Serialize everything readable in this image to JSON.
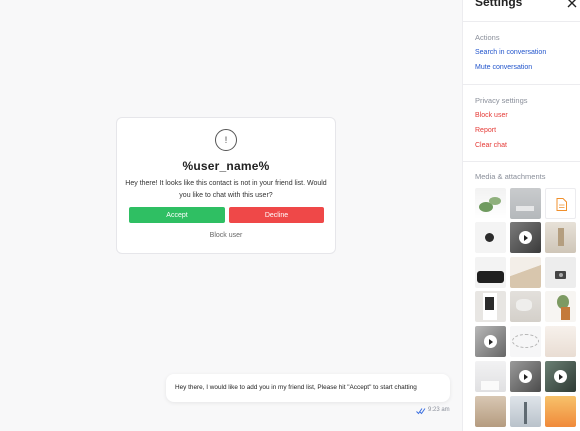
{
  "chat": {
    "request": {
      "user_name": "%user_name%",
      "message": "Hey there! It looks like this contact is not in your friend list. Would you like to chat with this user?",
      "accept_label": "Accept",
      "decline_label": "Decline",
      "block_label": "Block user",
      "icon": "info-icon"
    },
    "message": {
      "text": "Hey there, I would like to add you in my friend list, Please hit \"Accept\" to start chatting",
      "time": "9:23 am",
      "status_icon": "double-check-icon"
    }
  },
  "settings": {
    "title": "Settings",
    "actions": {
      "title": "Actions",
      "search": "Search in conversation",
      "mute": "Mute conversation"
    },
    "privacy": {
      "title": "Privacy settings",
      "block": "Block user",
      "report": "Report",
      "clear": "Clear chat"
    },
    "media": {
      "title": "Media & attachments"
    }
  },
  "colors": {
    "accent_blue": "#2255cc",
    "danger_red": "#e53935",
    "accept_green": "#2fbf63",
    "decline_red": "#ef4848"
  }
}
